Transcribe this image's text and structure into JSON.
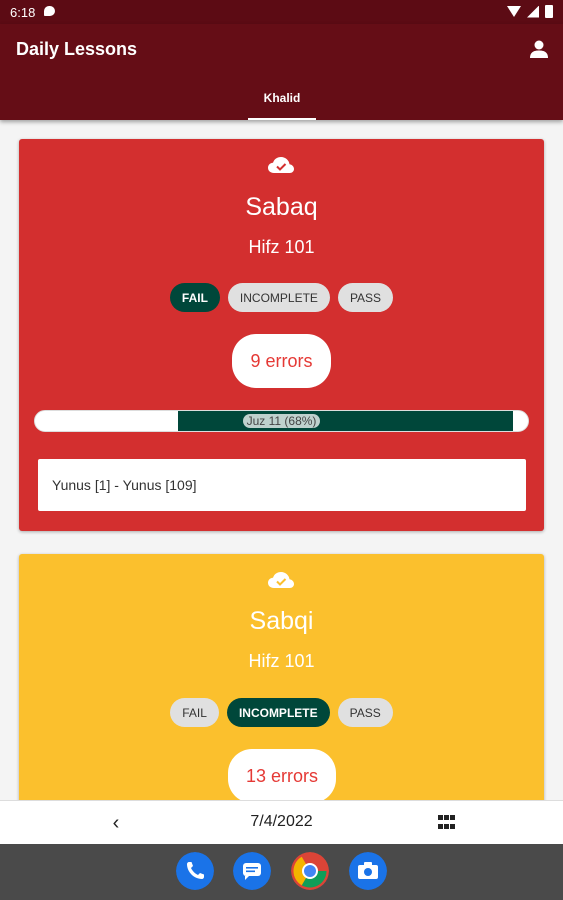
{
  "status_bar": {
    "time": "6:18"
  },
  "app_bar": {
    "title": "Daily Lessons",
    "tab": "Khalid",
    "profile_icon": "person-icon"
  },
  "cards": [
    {
      "title": "Sabaq",
      "subtitle": "Hifz 101",
      "color": "#d32f2f",
      "icon": "cloud-done-icon",
      "chips": [
        {
          "label": "FAIL",
          "selected": true
        },
        {
          "label": "INCOMPLETE",
          "selected": false
        },
        {
          "label": "PASS",
          "selected": false
        }
      ],
      "errors": "9 errors",
      "progress": {
        "label": "Juz 11 (68%)",
        "start_fraction": 0.29,
        "end_fraction": 0.97
      },
      "range": "Yunus [1] - Yunus [109]"
    },
    {
      "title": "Sabqi",
      "subtitle": "Hifz 101",
      "color": "#fbc02d",
      "icon": "cloud-done-icon",
      "chips": [
        {
          "label": "FAIL",
          "selected": false
        },
        {
          "label": "INCOMPLETE",
          "selected": true
        },
        {
          "label": "PASS",
          "selected": false
        }
      ],
      "errors": "13 errors"
    }
  ],
  "bottom_nav": {
    "prev_icon": "chevron-left-icon",
    "date": "7/4/2022",
    "grid_icon": "grid-icon"
  },
  "dock": {
    "apps": [
      "phone-icon",
      "messages-icon",
      "chrome-icon",
      "camera-icon"
    ]
  },
  "colors": {
    "app_bar": "#650d16",
    "status_bar": "#5c0b14",
    "selected_chip": "#00473a",
    "errors_text": "#e53935"
  }
}
